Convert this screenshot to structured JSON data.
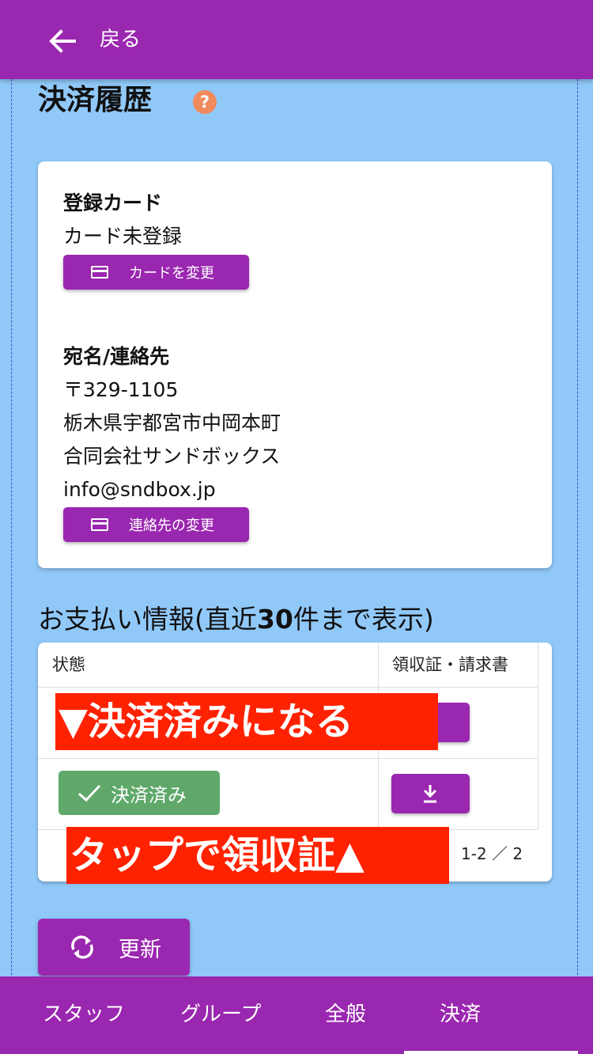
{
  "app_bar": {
    "back_label": "戻る"
  },
  "page": {
    "title": "決済履歴",
    "help_icon": "?"
  },
  "card": {
    "card_section_label": "登録カード",
    "card_status": "カード未登録",
    "change_card_button": "カードを変更",
    "address_section_label": "宛名/連絡先",
    "postal_code": "〒329-1105",
    "address_line": "栃木県宇都宮市中岡本町",
    "company_name": "合同会社サンドボックス",
    "email": "info@sndbox.jp",
    "change_contact_button": "連絡先の変更"
  },
  "payments": {
    "heading_prefix": "お支払い情報(直近",
    "heading_number": "30",
    "heading_suffix": "件まで表示)",
    "columns": {
      "status": "状態",
      "receipt": "領収証・請求書"
    },
    "rows": [
      {
        "status": "",
        "action_icon": "download-icon"
      },
      {
        "status": "決済済み",
        "status_icon": "check-icon",
        "action_icon": "download-icon"
      }
    ],
    "pagination": "1-2 ／ 2"
  },
  "overlays": {
    "top": "▼決済済みになる",
    "bottom": "タップで領収証▲"
  },
  "refresh_button": "更新",
  "bottom_nav": {
    "items": [
      "スタッフ",
      "グループ",
      "全般",
      "決済"
    ],
    "active": "決済"
  },
  "colors": {
    "primary": "#9a27b0",
    "background": "#90c8f8",
    "paid_green": "#5fa86a",
    "overlay_red": "#ff2200",
    "help_orange": "#f08a5d"
  }
}
